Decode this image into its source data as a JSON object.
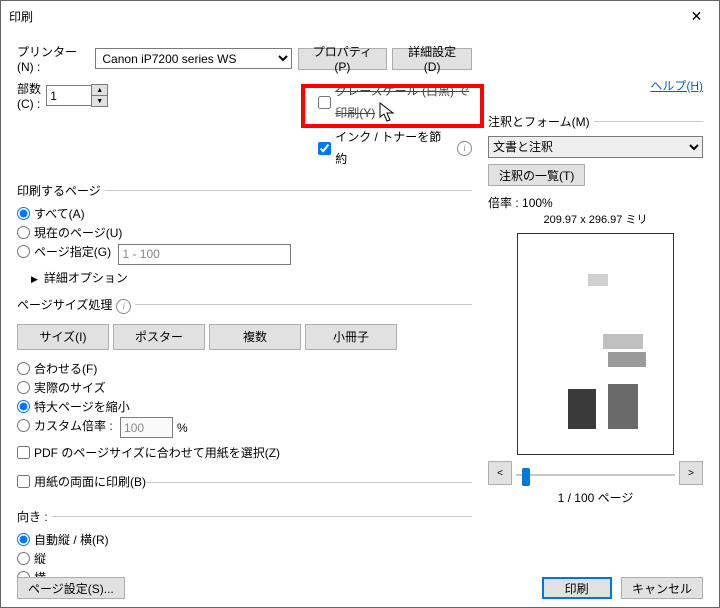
{
  "window": {
    "title": "印刷"
  },
  "top": {
    "printer_label": "プリンター(N) :",
    "printer_value": "Canon iP7200 series WS",
    "properties_btn": "プロパティ(P)",
    "advanced_btn": "詳細設定(D)",
    "help_link": "ヘルプ(H)",
    "copies_label": "部数(C) :",
    "copies_value": "1",
    "grayscale": "グレースケール (白黒) で印刷(Y)",
    "save_ink": "インク / トナーを節約"
  },
  "pages": {
    "legend": "印刷するページ",
    "all": "すべて(A)",
    "current": "現在のページ(U)",
    "range": "ページ指定(G)",
    "range_value": "1 - 100",
    "advanced": "詳細オプション"
  },
  "sizing": {
    "legend": "ページサイズ処理",
    "tabs": {
      "size": "サイズ(I)",
      "poster": "ポスター",
      "multi": "複数",
      "booklet": "小冊子"
    },
    "fit": "合わせる(F)",
    "actual": "実際のサイズ",
    "shrink": "特大ページを縮小",
    "custom": "カスタム倍率 :",
    "custom_value": "100",
    "percent": "%",
    "choose_paper": "PDF のページサイズに合わせて用紙を選択(Z)"
  },
  "duplex": {
    "label": "用紙の両面に印刷(B)"
  },
  "orient": {
    "legend": "向き :",
    "auto": "自動縦 / 横(R)",
    "portrait": "縦",
    "landscape": "横"
  },
  "annot": {
    "legend": "注釈とフォーム(M)",
    "select_value": "文書と注釈",
    "list_btn": "注釈の一覧(T)"
  },
  "preview": {
    "scale_label": "倍率 :",
    "scale_value": "100%",
    "dimensions": "209.97 x 296.97 ミリ",
    "prev": "<",
    "next": ">",
    "page_info": "1 / 100 ページ"
  },
  "footer": {
    "page_setup": "ページ設定(S)...",
    "print": "印刷",
    "cancel": "キャンセル"
  }
}
